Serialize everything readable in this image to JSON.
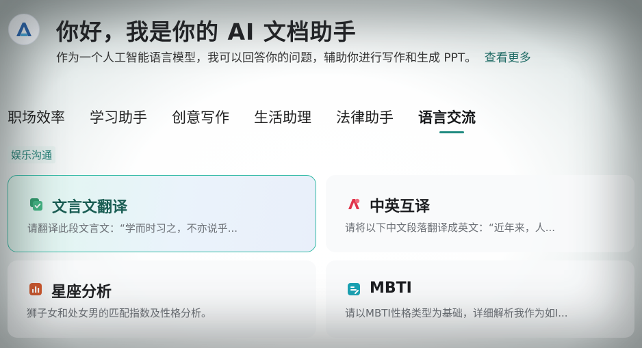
{
  "header": {
    "title": "你好，我是你的 AI 文档助手",
    "subtitle": "作为一个人工智能语言模型，我可以回答你的问题，辅助你进行写作和生成 PPT。",
    "more_link": "查看更多",
    "logo_icon": "ai-logo-icon"
  },
  "tabs": [
    {
      "label": "职场效率"
    },
    {
      "label": "学习助手"
    },
    {
      "label": "创意写作"
    },
    {
      "label": "生活助理"
    },
    {
      "label": "法律助手"
    },
    {
      "label": "语言交流",
      "active": true
    }
  ],
  "subtag": "娱乐沟通",
  "cards": [
    {
      "title": "文言文翻译",
      "desc": "请翻译此段文言文：“学而时习之，不亦说乎...",
      "icon": "green-chat-check-icon",
      "icon_color": "#2e9b6c",
      "active": true
    },
    {
      "title": "中英互译",
      "desc": "请将以下中文段落翻译成英文：“近年来，人...",
      "icon": "red-translate-icon",
      "icon_color": "#e0344b"
    },
    {
      "title": "星座分析",
      "desc": "狮子女和处女男的匹配指数及性格分析。",
      "icon": "orange-chart-icon",
      "icon_color": "#d2562a"
    },
    {
      "title": "MBTI",
      "desc": "请以MBTI性格类型为基础，详细解析我作为如I...",
      "icon": "teal-profile-icon",
      "icon_color": "#1aa2b3"
    }
  ],
  "colors": {
    "accent": "#1f8a80",
    "active_border": "#2fb9a4",
    "title_text": "#1e1f22"
  }
}
